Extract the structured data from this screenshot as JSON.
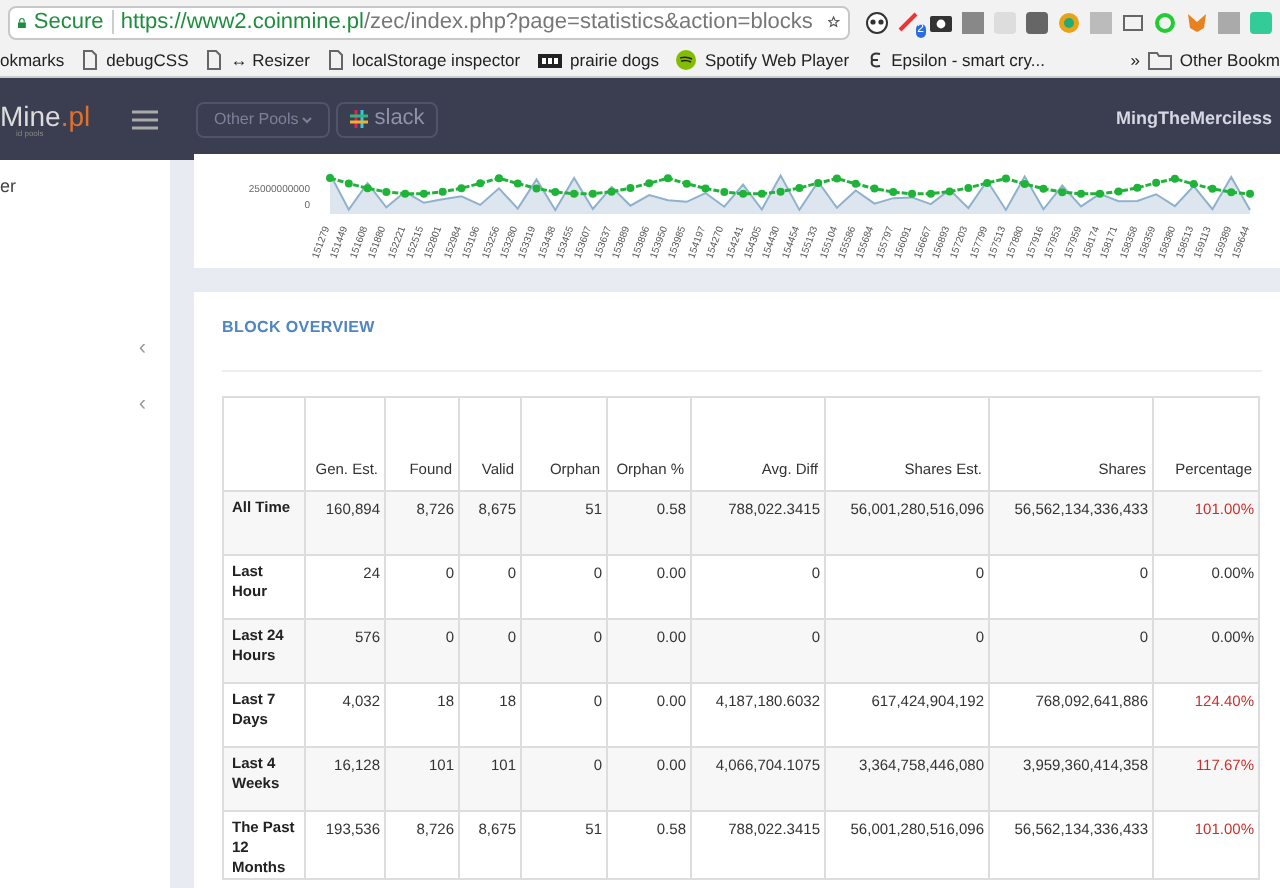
{
  "browser": {
    "secure_label": "Secure",
    "url_host": "https://www2.coinmine.pl",
    "url_path": "/zec/index.php?page=statistics&action=blocks",
    "extension_count": "2",
    "bookmarks": [
      {
        "label": "okmarks",
        "kind": "plain"
      },
      {
        "label": "debugCSS",
        "kind": "page"
      },
      {
        "label": "↔ Resizer",
        "kind": "page"
      },
      {
        "label": "localStorage inspector",
        "kind": "page"
      },
      {
        "label": "prairie dogs",
        "kind": "film"
      },
      {
        "label": "Spotify Web Player",
        "kind": "spotify"
      },
      {
        "label": "Epsilon - smart cry...",
        "kind": "epsilon"
      }
    ],
    "overflow": "»",
    "other_bookmarks": "Other Bookm"
  },
  "navbar": {
    "logo_main": "Mine",
    "logo_tld": ".pl",
    "logo_sub": "id pools",
    "pools_button": "Other Pools",
    "slack_label": "slack",
    "user": "MingTheMerciless"
  },
  "sidebar": {
    "item_text": "er",
    "chevrons": [
      "‹",
      "‹"
    ]
  },
  "chart": {
    "y_labels": [
      "25000000000",
      "0"
    ],
    "x_labels": [
      "151279",
      "151449",
      "151608",
      "151880",
      "152221",
      "152515",
      "152801",
      "152984",
      "153196",
      "153256",
      "153280",
      "153319",
      "153438",
      "153455",
      "153607",
      "153637",
      "153889",
      "153896",
      "153950",
      "153985",
      "154197",
      "154270",
      "154241",
      "154305",
      "154430",
      "154454",
      "155133",
      "155104",
      "155586",
      "155684",
      "155797",
      "156091",
      "156667",
      "156893",
      "157203",
      "157799",
      "157513",
      "157880",
      "157916",
      "157953",
      "157959",
      "158174",
      "158171",
      "158358",
      "158359",
      "158380",
      "158513",
      "159113",
      "159389",
      "159644"
    ]
  },
  "block_overview": {
    "title": "BLOCK OVERVIEW",
    "columns": [
      "Gen. Est.",
      "Found",
      "Valid",
      "Orphan",
      "Orphan %",
      "Avg. Diff",
      "Shares Est.",
      "Shares",
      "Percentage"
    ],
    "rows": [
      {
        "label": "All Time",
        "cells": [
          "160,894",
          "8,726",
          "8,675",
          "51",
          "0.58",
          "788,022.3415",
          "56,001,280,516,096",
          "56,562,134,336,433",
          "101.00%"
        ],
        "over": true
      },
      {
        "label": "Last Hour",
        "cells": [
          "24",
          "0",
          "0",
          "0",
          "0.00",
          "0",
          "0",
          "0",
          "0.00%"
        ],
        "over": false
      },
      {
        "label": "Last 24 Hours",
        "cells": [
          "576",
          "0",
          "0",
          "0",
          "0.00",
          "0",
          "0",
          "0",
          "0.00%"
        ],
        "over": false
      },
      {
        "label": "Last 7 Days",
        "cells": [
          "4,032",
          "18",
          "18",
          "0",
          "0.00",
          "4,187,180.6032",
          "617,424,904,192",
          "768,092,641,886",
          "124.40%"
        ],
        "over": true
      },
      {
        "label": "Last 4 Weeks",
        "cells": [
          "16,128",
          "101",
          "101",
          "0",
          "0.00",
          "4,066,704.1075",
          "3,364,758,446,080",
          "3,959,360,414,358",
          "117.67%"
        ],
        "over": true
      },
      {
        "label": "The Past 12 Months",
        "cells": [
          "193,536",
          "8,726",
          "8,675",
          "51",
          "0.58",
          "788,022.3415",
          "56,001,280,516,096",
          "56,562,134,336,433",
          "101.00%"
        ],
        "over": true
      }
    ]
  }
}
